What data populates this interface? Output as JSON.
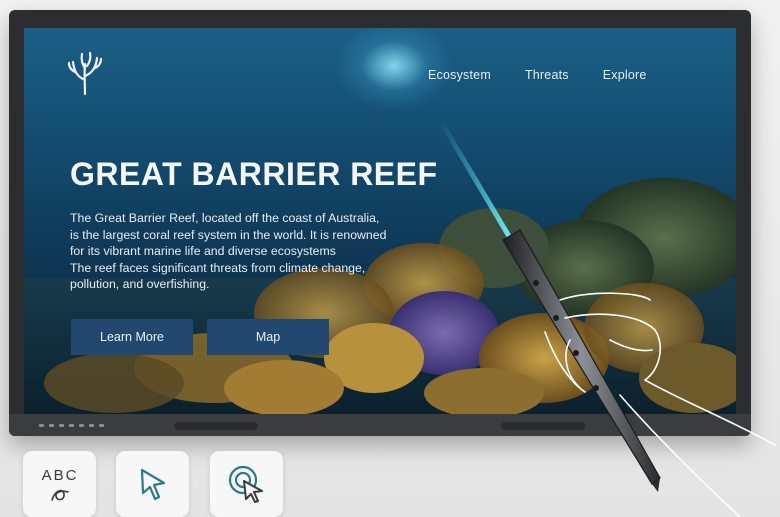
{
  "site": {
    "logo_icon": "coral-icon",
    "nav": [
      {
        "label": "Ecosystem"
      },
      {
        "label": "Threats"
      },
      {
        "label": "Explore"
      }
    ],
    "title": "GREAT BARRIER REEF",
    "description_lines": [
      "The Great Barrier Reef, located off the coast of Australia,",
      "is the largest coral reef system in the world. It is renowned",
      "for its vibrant marine life and diverse ecosystems",
      "The reef faces significant threats from climate change,",
      "pollution, and overfishing."
    ],
    "buttons": {
      "learn_more": "Learn More",
      "map": "Map"
    }
  },
  "tools": [
    {
      "name": "handwriting-tool",
      "label": "ABC",
      "icon": "handwriting-icon"
    },
    {
      "name": "pointer-tool",
      "icon": "cursor-arrow-icon"
    },
    {
      "name": "touch-select-tool",
      "icon": "touch-cursor-icon"
    }
  ],
  "colors": {
    "button_bg": "#23486f",
    "ocean_top": "#1b5f86",
    "ocean_bottom": "#0a2236",
    "laser": "#4fd6f0",
    "tool_icon": "#2b7a8c"
  }
}
